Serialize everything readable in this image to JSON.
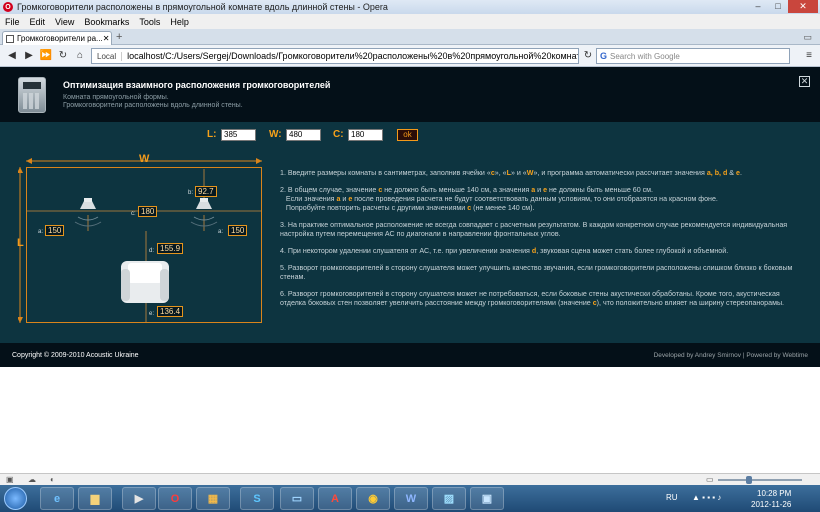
{
  "window": {
    "title": "Громкоговорители расположены в прямоугольной комнате вдоль длинной стены - Opera",
    "minimize": "–",
    "maximize": "□",
    "close": "✕"
  },
  "menu": [
    "File",
    "Edit",
    "View",
    "Bookmarks",
    "Tools",
    "Help"
  ],
  "tab": {
    "label": "Громкоговорители ра...",
    "close": "✕"
  },
  "new_tab": "+",
  "address": {
    "local_badge": "Local",
    "url": "localhost/C:/Users/Sergej/Downloads/Громкоговорители%20расположены%20в%20прямоугольной%20комнате%20вдоль%20",
    "search_placeholder": "Search with Google"
  },
  "page": {
    "title": "Оптимизация взаимного расположения громкоговорителей",
    "subtitle1": "Комната прямоугольной формы.",
    "subtitle2": "Громкоговорители расположены вдоль длинной стены.",
    "close": "✕",
    "inputs": {
      "L_label": "L:",
      "L_value": "385",
      "W_label": "W:",
      "W_value": "480",
      "C_label": "C:",
      "C_value": "180",
      "ok": "ok"
    },
    "diagram": {
      "W": "W",
      "L": "L",
      "a_left": "150",
      "a_right": "150",
      "b": "92.7",
      "c": "180",
      "d": "155.9",
      "e": "136.4",
      "a_lab": "a:",
      "b_lab": "b:",
      "c_lab": "c:",
      "d_lab": "d:",
      "e_lab": "e:"
    },
    "instructions": [
      {
        "parts": [
          "1. Введите размеры комнаты в сантиметрах, заполнив ячейки «",
          "c",
          "», «",
          "L",
          "» и «",
          "W",
          "», и программа автоматически рассчитает значения ",
          "a, b, d",
          " & ",
          "e",
          "."
        ]
      },
      {
        "parts": [
          "2. В общем случае, значение ",
          "c",
          " не должно быть меньше 140 см, а значения ",
          "a",
          " и ",
          "e",
          " не должны быть меньше 60 см."
        ]
      },
      {
        "parts": [
          "Если значения ",
          "a",
          " и ",
          "e",
          " после проведения расчета не будут соответствовать данным условиям, то они отобразятся на красном фоне."
        ]
      },
      {
        "parts": [
          "Попробуйте повторить расчеты с другими значениями ",
          "c",
          " (не менее 140 см)."
        ]
      },
      {
        "parts": [
          "3. На практике оптимальное расположение не всегда совпадает с расчетным результатом. В каждом конкретном случае рекомендуется индивидуальная настройка путем перемещения АС по диагонали в направлении фронтальных углов."
        ]
      },
      {
        "parts": [
          "4. При некотором удалении слушателя от АС, т.е. при увеличении значения ",
          "d",
          ", звуковая сцена может стать более глубокой и объемной."
        ]
      },
      {
        "parts": [
          "5. Разворот громкоговорителей в сторону слушателя может улучшить качество звучания, если громкоговорители расположены слишком близко к боковым стенам."
        ]
      },
      {
        "parts": [
          "6. Разворот громкоговорителей в сторону слушателя может не потребоваться, если боковые стены акустически обработаны. Кроме того, акустическая отделка боковых стен позволяет увеличить расстояние между громкоговорителями (значение ",
          "c",
          "), что положительно влияет на ширину стереопанорамы."
        ]
      }
    ],
    "footer_left": "Copyright © 2009-2010 Acoustic Ukraine",
    "footer_right": "Developed by Andrey Smirnov | Powered by Webtime"
  },
  "taskbar": {
    "lang": "RU",
    "time": "10:28 PM",
    "date": "2012-11-26"
  }
}
